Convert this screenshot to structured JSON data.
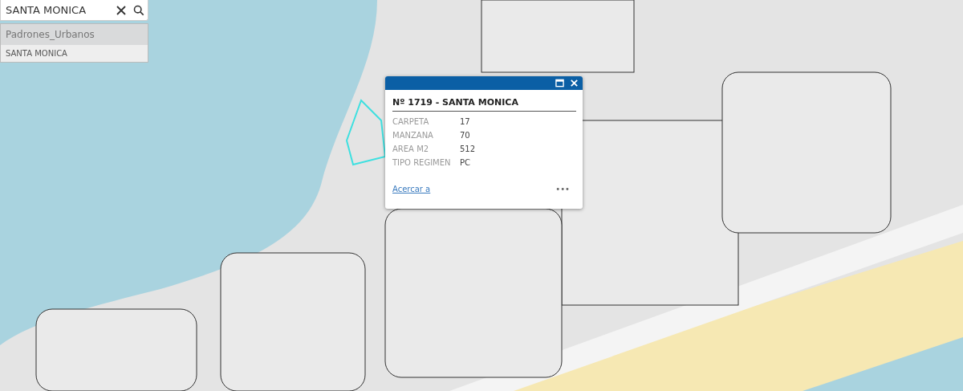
{
  "search": {
    "value": "SANTA MONICA"
  },
  "suggestions": {
    "group": "Padrones_Urbanos",
    "items": [
      {
        "label": "SANTA MONICA",
        "selected": false
      }
    ]
  },
  "popup": {
    "title": "Nº 1719 - SANTA MONICA",
    "fields": [
      {
        "label": "CARPETA",
        "value": "17"
      },
      {
        "label": "MANZANA",
        "value": "70"
      },
      {
        "label": "AREA M2",
        "value": "512"
      },
      {
        "label": "TIPO REGIMEN",
        "value": "PC"
      }
    ],
    "link": "Acercar a",
    "menu": "•••"
  }
}
